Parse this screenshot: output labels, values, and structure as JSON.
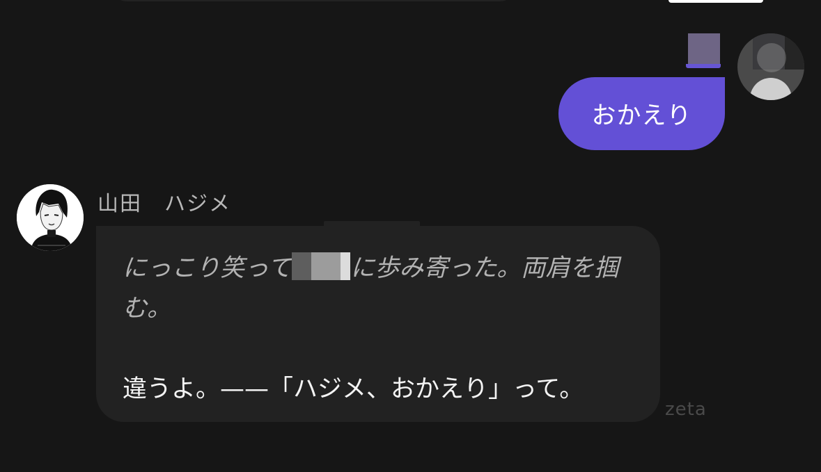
{
  "user_message": {
    "text": "おかえり",
    "bubble_color": "#6350d6"
  },
  "bot": {
    "name": "山田　ハジメ",
    "action_before_redaction": "にっこり笑って",
    "action_after_redaction": "に歩み寄った。両肩を掴む。",
    "speech": "違うよ。——「ハジメ、おかえり」って。"
  },
  "watermark": "zeta",
  "colors": {
    "background": "#161616",
    "bot_bubble": "#222222",
    "user_bubble": "#6350d6"
  },
  "icons": {
    "user_avatar": "user-avatar-image",
    "bot_avatar": "bot-character-avatar"
  }
}
